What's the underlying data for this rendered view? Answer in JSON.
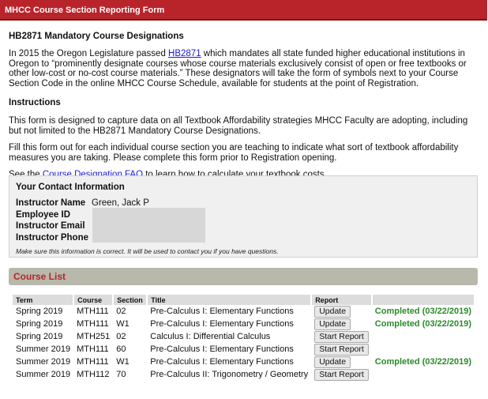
{
  "window": {
    "title": "MHCC Course Section Reporting Form"
  },
  "intro": {
    "heading": "HB2871 Mandatory Course Designations",
    "p1_before_link": "In 2015 the Oregon Legislature passed ",
    "p1_link": "HB2871",
    "p1_after_link": " which mandates all state funded higher educational institutions in Oregon to “prominently designate courses whose course materials exclusively consist of open or free textbooks or other low-cost or no-cost course materials.” These designators will take the form of symbols next to your Course Section Code in the online MHCC Course Schedule, available for students at the point of Registration."
  },
  "instructions": {
    "heading": "Instructions",
    "p1": "This form is designed to capture data on all Textbook Affordability strategies MHCC Faculty are adopting, including but not limited to the HB2871 Mandatory Course Designations.",
    "p2": "Fill this form out for each individual course section you are teaching to indicate what sort of textbook affordability measures you are taking. Please complete this form prior to Registration opening.",
    "p3_before_link": "See the ",
    "p3_link": "Course Designation FAQ",
    "p3_after_link": " to learn how to calculate your textbook costs."
  },
  "contact": {
    "title": "Your Contact Information",
    "rows": [
      {
        "label": "Instructor Name",
        "value": "Green, Jack P"
      },
      {
        "label": "Employee ID",
        "value": ""
      },
      {
        "label": "Instructor Email",
        "value": ""
      },
      {
        "label": "Instructor Phone",
        "value": ""
      }
    ],
    "note": "Make sure this information is correct. It will be used to contact you if you have questions."
  },
  "course_list": {
    "title": "Course List",
    "headers": [
      "Term",
      "Course",
      "Section",
      "Title",
      "Report",
      ""
    ],
    "rows": [
      {
        "term": "Spring 2019",
        "course": "MTH111",
        "section": "02",
        "title": "Pre-Calculus I: Elementary Functions",
        "action": "Update",
        "status": "Completed (03/22/2019)"
      },
      {
        "term": "Spring 2019",
        "course": "MTH111",
        "section": "W1",
        "title": "Pre-Calculus I: Elementary Functions",
        "action": "Update",
        "status": "Completed (03/22/2019)"
      },
      {
        "term": "Spring 2019",
        "course": "MTH251",
        "section": "02",
        "title": "Calculus I: Differential Calculus",
        "action": "Start Report",
        "status": ""
      },
      {
        "term": "Summer 2019",
        "course": "MTH111",
        "section": "60",
        "title": "Pre-Calculus I: Elementary Functions",
        "action": "Start Report",
        "status": ""
      },
      {
        "term": "Summer 2019",
        "course": "MTH111",
        "section": "W1",
        "title": "Pre-Calculus I: Elementary Functions",
        "action": "Update",
        "status": "Completed (03/22/2019)"
      },
      {
        "term": "Summer 2019",
        "course": "MTH112",
        "section": "70",
        "title": "Pre-Calculus II: Trigonometry / Geometry",
        "action": "Start Report",
        "status": ""
      }
    ]
  },
  "colors": {
    "accent": "#b9242b",
    "success": "#2a8a2a",
    "link": "#1a1ad6"
  }
}
